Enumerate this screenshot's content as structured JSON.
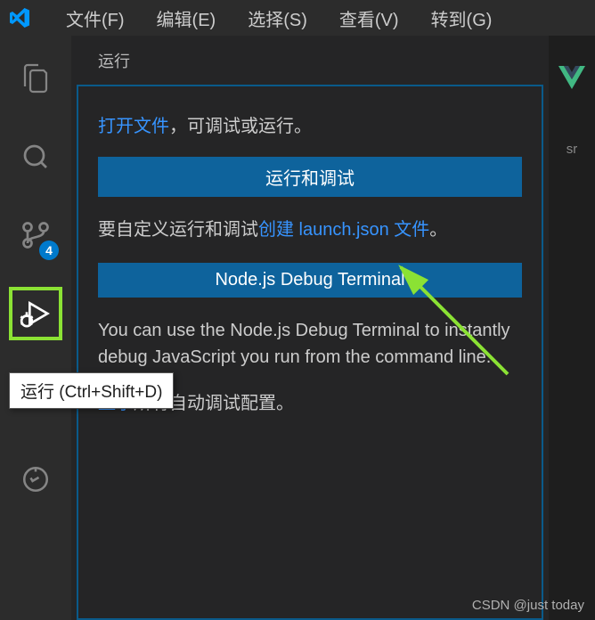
{
  "menubar": {
    "items": [
      "文件(F)",
      "编辑(E)",
      "选择(S)",
      "查看(V)",
      "转到(G)"
    ]
  },
  "activityBar": {
    "badge": "4",
    "tooltip": "运行 (Ctrl+Shift+D)"
  },
  "sidebar": {
    "title": "运行",
    "openFileLink": "打开文件",
    "openFileSuffix": "，可调试或运行。",
    "runDebugBtn": "运行和调试",
    "customizePrefix": "要自定义运行和调试",
    "createLaunchLink": "创建 launch.json 文件",
    "customizeSuffix": "。",
    "nodeDebugBtn": "Node.js Debug Terminal",
    "nodeDesc": "You can use the Node.js Debug Terminal to instantly debug JavaScript you run from the command line.",
    "showAllPrefix": "显示",
    "showAllSuffix": "所有自动调试配置。"
  },
  "right": {
    "vIcon": "V",
    "srcText": "sr"
  },
  "watermark": "CSDN @just today"
}
